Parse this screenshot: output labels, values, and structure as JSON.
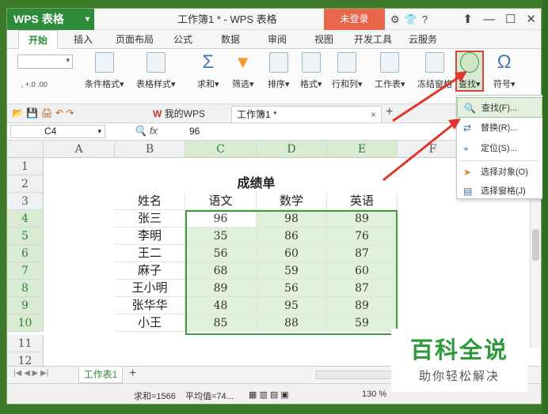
{
  "app": {
    "logo": "WPS 表格",
    "title": "工作簿1 * - WPS 表格",
    "login": "未登录",
    "help": "?",
    "accent": "#2e8b3a"
  },
  "tabs": [
    "开始",
    "插入",
    "页面布局",
    "公式",
    "数据",
    "审阅",
    "视图",
    "开发工具",
    "云服务"
  ],
  "ribbon": {
    "cond_format": "条件格式",
    "table_style": "表格样式",
    "sum": "求和",
    "filter": "筛选",
    "sort": "排序",
    "format": "格式",
    "rowcol": "行和列",
    "sheet": "工作表",
    "freeze": "冻结窗格",
    "find": "查找",
    "symbol": "符号",
    "sigma": "Σ",
    "omega": "Ω"
  },
  "quickbar": {
    "mywps": "我的WPS",
    "doc_tab": "工作簿1 *"
  },
  "formula": {
    "cell_ref": "C4",
    "fx": "fx",
    "value": "96"
  },
  "columns": [
    "A",
    "B",
    "C",
    "D",
    "E",
    "F"
  ],
  "rows": [
    "1",
    "2",
    "3",
    "4",
    "5",
    "6",
    "7",
    "8",
    "9",
    "10",
    "11",
    "12"
  ],
  "sheet": {
    "title": "成绩单",
    "headers": [
      "姓名",
      "语文",
      "数学",
      "英语"
    ],
    "records": [
      [
        "张三",
        "96",
        "98",
        "89"
      ],
      [
        "李明",
        "35",
        "86",
        "76"
      ],
      [
        "王二",
        "56",
        "60",
        "87"
      ],
      [
        "麻子",
        "68",
        "59",
        "60"
      ],
      [
        "王小明",
        "89",
        "56",
        "87"
      ],
      [
        "张华华",
        "48",
        "95",
        "89"
      ],
      [
        "小王",
        "85",
        "88",
        "59"
      ]
    ]
  },
  "sheet_tab": "工作表1",
  "status": {
    "sum": "求和=1566",
    "avg": "平均值=74...",
    "zoom": "130 %"
  },
  "find_menu": [
    {
      "label": "查找(F)...",
      "icon": "find-icon"
    },
    {
      "label": "替换(R)...",
      "icon": "replace-icon"
    },
    {
      "label": "定位(S)...",
      "icon": "goto-icon"
    },
    {
      "label": "选择对象(O)",
      "icon": "select-object-icon"
    },
    {
      "label": "选择窗格(J)",
      "icon": "selection-pane-icon"
    }
  ],
  "watermark": {
    "title": "百科全说",
    "subtitle": "助你轻松解决"
  }
}
